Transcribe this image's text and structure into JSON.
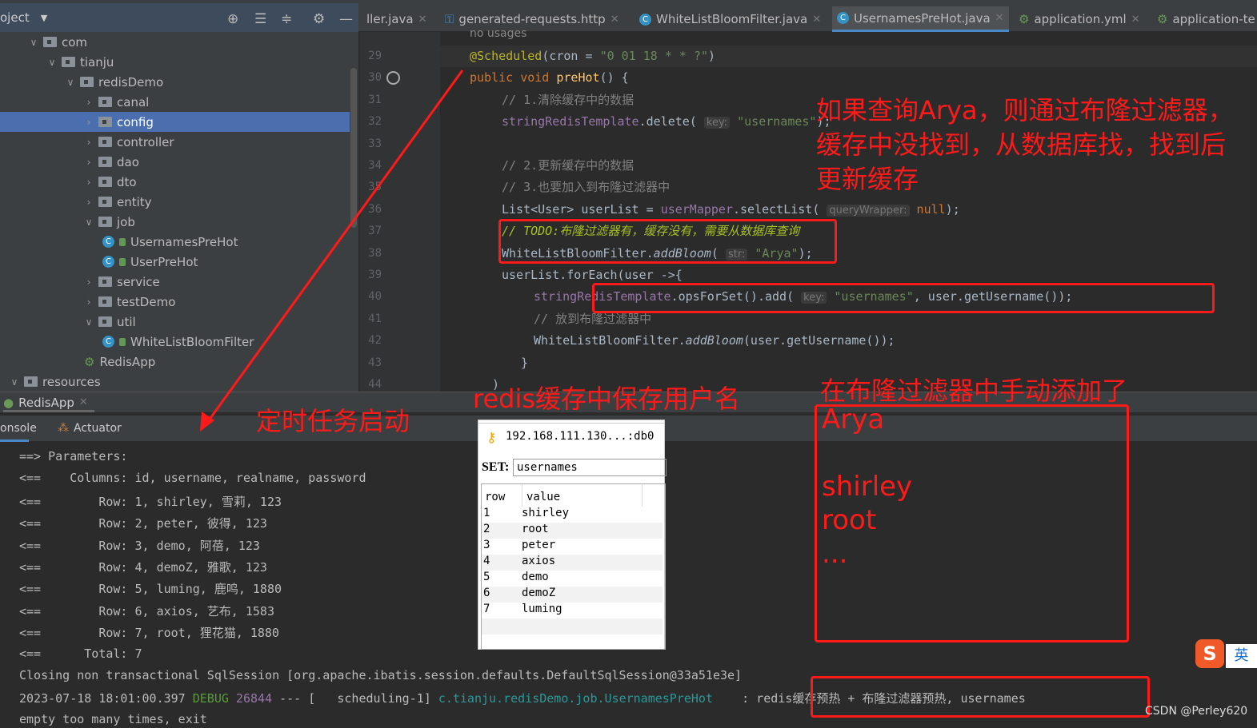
{
  "project_panel": {
    "title": "oject",
    "tree": [
      {
        "label": "com",
        "level": 0,
        "type": "folder",
        "open": true
      },
      {
        "label": "tianju",
        "level": 1,
        "type": "folder",
        "open": true
      },
      {
        "label": "redisDemo",
        "level": 2,
        "type": "folder",
        "open": true
      },
      {
        "label": "canal",
        "level": 3,
        "type": "folder",
        "open": false
      },
      {
        "label": "config",
        "level": 3,
        "type": "folder",
        "open": false,
        "selected": true
      },
      {
        "label": "controller",
        "level": 3,
        "type": "folder",
        "open": false
      },
      {
        "label": "dao",
        "level": 3,
        "type": "folder",
        "open": false
      },
      {
        "label": "dto",
        "level": 3,
        "type": "folder",
        "open": false
      },
      {
        "label": "entity",
        "level": 3,
        "type": "folder",
        "open": false
      },
      {
        "label": "job",
        "level": 3,
        "type": "folder",
        "open": true
      },
      {
        "label": "UsernamesPreHot",
        "level": 4,
        "type": "class"
      },
      {
        "label": "UserPreHot",
        "level": 4,
        "type": "class"
      },
      {
        "label": "service",
        "level": 3,
        "type": "folder",
        "open": false
      },
      {
        "label": "testDemo",
        "level": 3,
        "type": "folder",
        "open": false
      },
      {
        "label": "util",
        "level": 3,
        "type": "folder",
        "open": true
      },
      {
        "label": "WhiteListBloomFilter",
        "level": 4,
        "type": "class"
      },
      {
        "label": "RedisApp",
        "level": 3,
        "type": "app"
      },
      {
        "label": "resources",
        "level": -1,
        "type": "folder",
        "open": true
      }
    ]
  },
  "tabs": [
    {
      "label": "ller.java",
      "icon": "none"
    },
    {
      "label": "generated-requests.http",
      "icon": "api-icon"
    },
    {
      "label": "WhiteListBloomFilter.java",
      "icon": "class-icon"
    },
    {
      "label": "UsernamesPreHot.java",
      "icon": "class-icon",
      "active": true
    },
    {
      "label": "application.yml",
      "icon": "spring-icon"
    },
    {
      "label": "application-te",
      "icon": "spring-icon"
    }
  ],
  "editor": {
    "usages": "no usages",
    "lines": [
      {
        "n": "29",
        "indent": 0,
        "seg": [
          [
            "@Scheduled",
            "ann"
          ],
          [
            "(cron = ",
            ""
          ],
          [
            "\"0 01 18 * * ?\"",
            "str"
          ],
          [
            ")",
            ""
          ]
        ]
      },
      {
        "n": "30",
        "indent": 0,
        "seg": [
          [
            "public void ",
            "kw"
          ],
          [
            "preHot",
            "fn"
          ],
          [
            "() {",
            ""
          ]
        ]
      },
      {
        "n": "31",
        "indent": 1,
        "seg": [
          [
            "// 1.清除缓存中的数据",
            "cm"
          ]
        ]
      },
      {
        "n": "32",
        "indent": 1,
        "seg": [
          [
            "stringRedisTemplate",
            "fld"
          ],
          [
            ".delete( ",
            ""
          ],
          [
            "key:",
            "hint"
          ],
          [
            " \"usernames\"",
            "str"
          ],
          [
            ");",
            ""
          ]
        ]
      },
      {
        "n": "33",
        "indent": 1,
        "seg": []
      },
      {
        "n": "34",
        "indent": 1,
        "seg": [
          [
            "// 2.更新缓存中的数据",
            "cm"
          ]
        ]
      },
      {
        "n": "35",
        "indent": 1,
        "seg": [
          [
            "// 3.也要加入到布隆过滤器中",
            "cm"
          ]
        ]
      },
      {
        "n": "36",
        "indent": 1,
        "seg": [
          [
            "List<User> userList = ",
            ""
          ],
          [
            "userMapper",
            "fld"
          ],
          [
            ".selectList( ",
            ""
          ],
          [
            "queryWrapper:",
            "hint"
          ],
          [
            " null",
            "kw"
          ],
          [
            ");",
            ""
          ]
        ]
      },
      {
        "n": "37",
        "indent": 1,
        "seg": [
          [
            "// TODO:布隆过滤器有，缓存没有，需要从数据库查询",
            "todo"
          ]
        ]
      },
      {
        "n": "38",
        "indent": 1,
        "seg": [
          [
            "WhiteListBloomFilter.",
            ""
          ],
          [
            "addBloom",
            "it"
          ],
          [
            "( ",
            ""
          ],
          [
            "str:",
            "hint"
          ],
          [
            " \"Arya\"",
            "str"
          ],
          [
            ");",
            ""
          ]
        ]
      },
      {
        "n": "39",
        "indent": 1,
        "seg": [
          [
            "userList.forEach(user ->{",
            ""
          ]
        ]
      },
      {
        "n": "40",
        "indent": 2,
        "seg": [
          [
            "stringRedisTemplate",
            "fld"
          ],
          [
            ".opsForSet().add( ",
            ""
          ],
          [
            "key:",
            "hint"
          ],
          [
            " \"usernames\"",
            "str"
          ],
          [
            ", user.getUsername());",
            ""
          ]
        ]
      },
      {
        "n": "41",
        "indent": 2,
        "seg": [
          [
            "// 放到布隆过滤器中",
            "cm"
          ]
        ]
      },
      {
        "n": "42",
        "indent": 2,
        "seg": [
          [
            "WhiteListBloomFilter.",
            ""
          ],
          [
            "addBloom",
            "it"
          ],
          [
            "(user.getUsername());",
            ""
          ]
        ]
      },
      {
        "n": "43",
        "indent": 1.6,
        "seg": [
          [
            "}",
            ""
          ]
        ]
      },
      {
        "n": "44",
        "indent": 0.7,
        "seg": [
          [
            ")",
            ""
          ]
        ]
      }
    ]
  },
  "run": {
    "tab": "RedisApp",
    "console_tab": "onsole",
    "actuator_tab": "Actuator"
  },
  "console": {
    "lines": [
      [
        [
          "==> Parameters:",
          ""
        ]
      ],
      [
        [
          "<==    Columns: id, username, realname, password",
          ""
        ]
      ],
      [
        [
          "<==        Row: 1, shirley, 雪莉, 123",
          ""
        ]
      ],
      [
        [
          "<==        Row: 2, peter, 彼得, 123",
          ""
        ]
      ],
      [
        [
          "<==        Row: 3, demo, 阿蓓, 123",
          ""
        ]
      ],
      [
        [
          "<==        Row: 4, demoZ, 雅歌, 123",
          ""
        ]
      ],
      [
        [
          "<==        Row: 5, luming, 鹿鸣, 1880",
          ""
        ]
      ],
      [
        [
          "<==        Row: 6, axios, 艺布, 1583",
          ""
        ]
      ],
      [
        [
          "<==        Row: 7, root, 狸花猫, 1880",
          ""
        ]
      ],
      [
        [
          "<==      Total: 7",
          ""
        ]
      ],
      [
        [
          "Closing non transactional SqlSession [org.apache.ibatis.session.defaults.DefaultSqlSession@33a51e3e]",
          ""
        ]
      ],
      [
        [
          "2023-07-18 18:01:00.397 ",
          ""
        ],
        [
          "DEBUG",
          "dbg"
        ],
        [
          " 26844",
          "pid"
        ],
        [
          " --- [   scheduling-1] ",
          ""
        ],
        [
          "c.tianju.redisDemo.job.UsernamesPreHot",
          "cls"
        ],
        [
          "    : redis缓存预热 + 布隆过滤器预热, usernames",
          ""
        ]
      ],
      [
        [
          "empty too many times, exit",
          ""
        ]
      ]
    ]
  },
  "redis_popup": {
    "connection": "192.168.111.130...:db0",
    "type_label": "SET:",
    "key": "usernames",
    "columns": [
      "row",
      "value"
    ],
    "rows": [
      [
        "1",
        "shirley"
      ],
      [
        "2",
        "root"
      ],
      [
        "3",
        "peter"
      ],
      [
        "4",
        "axios"
      ],
      [
        "5",
        "demo"
      ],
      [
        "6",
        "demoZ"
      ],
      [
        "7",
        "luming"
      ]
    ]
  },
  "annotations": {
    "bloom_note": [
      "如果查询Arya，则通过布隆过滤器，",
      "缓存中没找到，从数据库找，找到后",
      "更新缓存"
    ],
    "scheduled_note": "定时任务启动",
    "redis_note": "redis缓存中保存用户名",
    "manual_note": "在布隆过滤器中手动添加了",
    "manual_list": [
      "Arya",
      "",
      "shirley",
      "root",
      "..."
    ],
    "color": "#ff1a1a"
  },
  "watermark": "CSDN @Perley620",
  "ime": {
    "label": "英"
  }
}
